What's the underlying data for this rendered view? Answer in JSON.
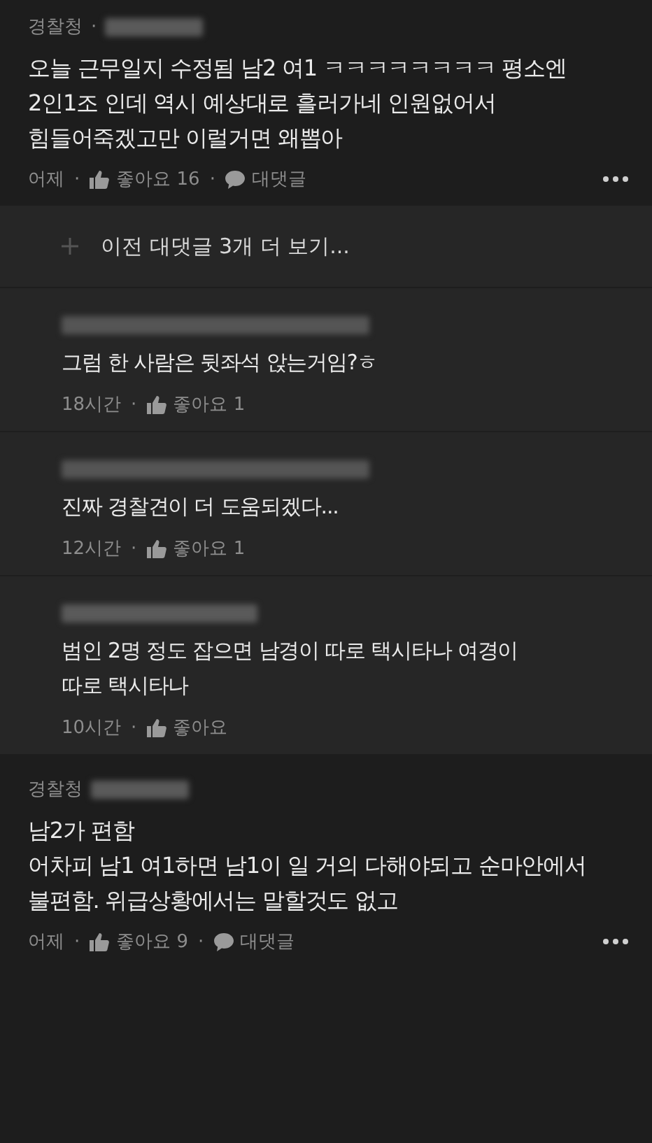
{
  "comments": [
    {
      "author": "경찰청",
      "separator": "·",
      "body": "오늘 근무일지 수정됨 남2 여1 ㅋㅋㅋㅋㅋㅋㅋㅋ 평소엔\n2인1조 인데 역시 예상대로 흘러가네 인원없어서\n힘들어죽겠고만 이럴거면 왜뽑아",
      "meta": [
        {
          "kind": "text",
          "text": "어제"
        },
        {
          "kind": "dot",
          "text": "·"
        },
        {
          "kind": "like",
          "text": "좋아요 16"
        },
        {
          "kind": "dot",
          "text": "·"
        },
        {
          "kind": "reply",
          "text": "대댓글"
        }
      ],
      "thread": {
        "more_label": "이전 대댓글 3개 더 보기...",
        "replies": [
          {
            "body": "그럼 한 사람은 뒷좌석 앉는거임?ㅎ",
            "meta": [
              {
                "kind": "text",
                "text": "18시간"
              },
              {
                "kind": "dot",
                "text": "·"
              },
              {
                "kind": "like",
                "text": "좋아요 1"
              }
            ]
          },
          {
            "body": "진짜 경찰견이 더 도움되겠다...",
            "meta": [
              {
                "kind": "text",
                "text": "12시간"
              },
              {
                "kind": "dot",
                "text": "·"
              },
              {
                "kind": "like",
                "text": "좋아요 1"
              }
            ]
          },
          {
            "body": "범인 2명 정도 잡으면 남경이 따로 택시타나 여경이\n따로 택시타나",
            "meta": [
              {
                "kind": "text",
                "text": "10시간"
              },
              {
                "kind": "dot",
                "text": "·"
              },
              {
                "kind": "like",
                "text": "좋아요"
              }
            ]
          }
        ]
      }
    },
    {
      "author": "경찰청",
      "body": "남2가 편함\n어차피 남1 여1하면 남1이 일 거의 다해야되고 순마안에서\n불편함. 위급상황에서는 말할것도 없고",
      "meta": [
        {
          "kind": "text",
          "text": "어제"
        },
        {
          "kind": "dot",
          "text": "·"
        },
        {
          "kind": "like",
          "text": "좋아요 9"
        },
        {
          "kind": "dot",
          "text": "·"
        },
        {
          "kind": "reply",
          "text": "대댓글"
        }
      ]
    }
  ]
}
